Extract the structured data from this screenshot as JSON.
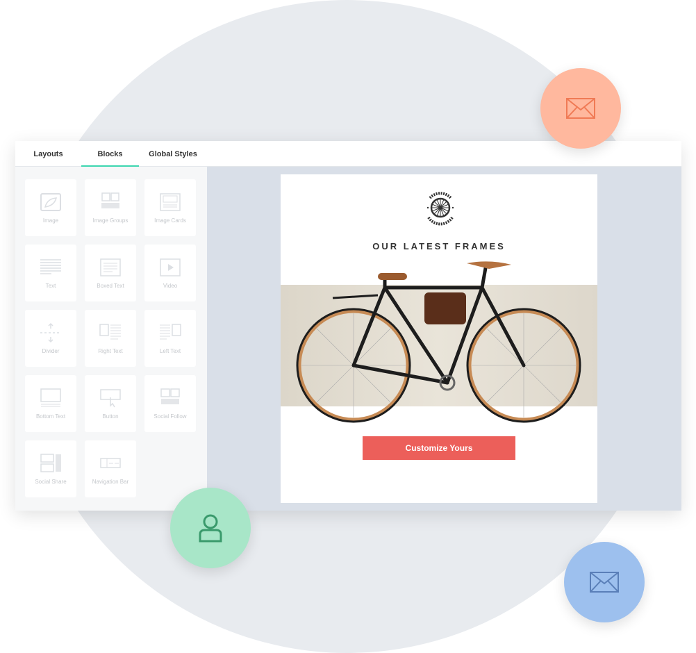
{
  "tabs": [
    {
      "label": "Layouts"
    },
    {
      "label": "Blocks",
      "active": true
    },
    {
      "label": "Global Styles"
    }
  ],
  "blocks": [
    {
      "label": "Image",
      "icon": "image-icon"
    },
    {
      "label": "Image Groups",
      "icon": "image-groups-icon"
    },
    {
      "label": "Image Cards",
      "icon": "image-cards-icon"
    },
    {
      "label": "Text",
      "icon": "text-icon"
    },
    {
      "label": "Boxed Text",
      "icon": "boxed-text-icon"
    },
    {
      "label": "Video",
      "icon": "video-icon"
    },
    {
      "label": "Divider",
      "icon": "divider-icon"
    },
    {
      "label": "Right Text",
      "icon": "right-text-icon"
    },
    {
      "label": "Left Text",
      "icon": "left-text-icon"
    },
    {
      "label": "Bottom Text",
      "icon": "bottom-text-icon"
    },
    {
      "label": "Button",
      "icon": "button-icon"
    },
    {
      "label": "Social Follow",
      "icon": "social-follow-icon"
    },
    {
      "label": "Social Share",
      "icon": "social-share-icon"
    },
    {
      "label": "Navigation Bar",
      "icon": "navigation-bar-icon"
    }
  ],
  "email": {
    "logo_text": "BYCICLES HANDCRAFTED",
    "headline": "OUR LATEST FRAMES",
    "cta": "Customize Yours",
    "cta_color": "#ec5f5a"
  },
  "colors": {
    "accent": "#3dd6b0",
    "orange_bubble": "#ffb89e",
    "green_bubble": "#a8e6c8",
    "blue_bubble": "#9dc0ee"
  },
  "bubbles": [
    {
      "icon": "envelope-icon",
      "color": "#ffb89e"
    },
    {
      "icon": "user-icon",
      "color": "#a8e6c8"
    },
    {
      "icon": "envelope-icon",
      "color": "#9dc0ee"
    }
  ]
}
